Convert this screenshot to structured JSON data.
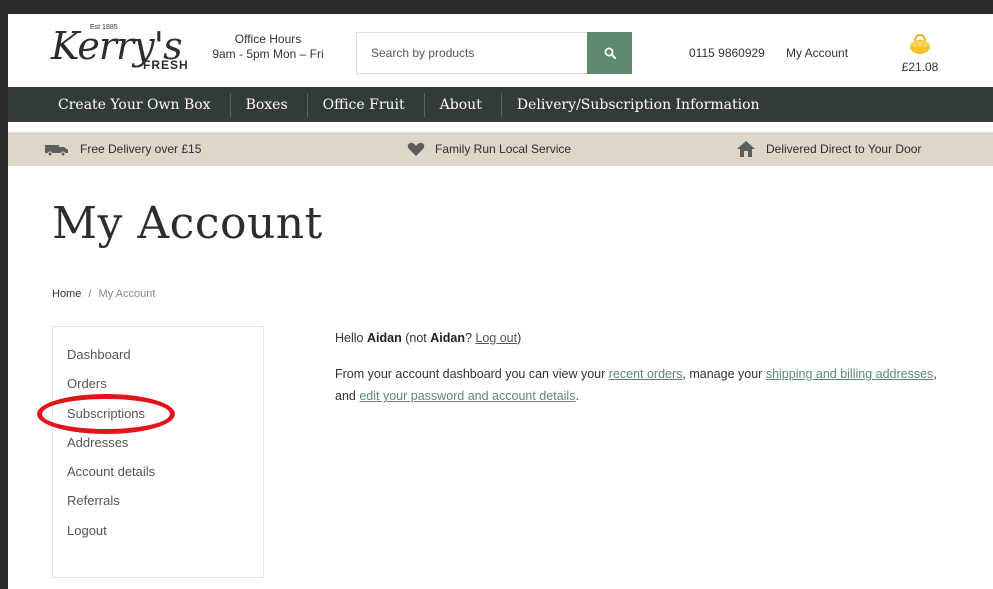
{
  "header": {
    "logo": {
      "est": "Est 1885",
      "name": "Kerry's",
      "sub": "FRESH"
    },
    "office_hours_title": "Office Hours",
    "office_hours_value": "9am - 5pm Mon – Fri",
    "search": {
      "placeholder": "Search by products",
      "button_icon": "search-icon"
    },
    "phone": "0115 9860929",
    "account_link": "My Account",
    "cart": {
      "icon": "basket-icon",
      "total": "£21.08"
    }
  },
  "nav": {
    "items": [
      {
        "label": "Create Your Own Box"
      },
      {
        "label": "Boxes"
      },
      {
        "label": "Office Fruit"
      },
      {
        "label": "About"
      },
      {
        "label": "Delivery/Subscription Information"
      }
    ]
  },
  "benefits": [
    {
      "icon": "delivery-truck-icon",
      "label": "Free Delivery over £15"
    },
    {
      "icon": "heart-icon",
      "label": "Family Run Local Service"
    },
    {
      "icon": "house-icon",
      "label": "Delivered Direct to Your Door"
    }
  ],
  "page_title": "My Account",
  "breadcrumb": {
    "home": "Home",
    "separator": "/",
    "current": "My Account"
  },
  "sidebar": {
    "items": [
      {
        "label": "Dashboard"
      },
      {
        "label": "Orders"
      },
      {
        "label": "Subscriptions"
      },
      {
        "label": "Addresses"
      },
      {
        "label": "Account details"
      },
      {
        "label": "Referrals"
      },
      {
        "label": "Logout"
      }
    ]
  },
  "content": {
    "hello": "Hello",
    "user": "Aidan",
    "not_open": "(not",
    "not_user": "Aidan",
    "not_q": "?",
    "logout": "Log out",
    "close": ")",
    "intro": "From your account dashboard you can view your",
    "recent_orders": "recent orders",
    "manage": ", manage your",
    "shipping": "shipping and billing addresses",
    "and": ", and",
    "edit": "edit your password and account details",
    "period": "."
  },
  "colors": {
    "nav_bg": "#333b39",
    "benefit_bg": "#ded6c8",
    "accent_green": "#5f8a6e",
    "annotation_red": "#e1141c"
  }
}
